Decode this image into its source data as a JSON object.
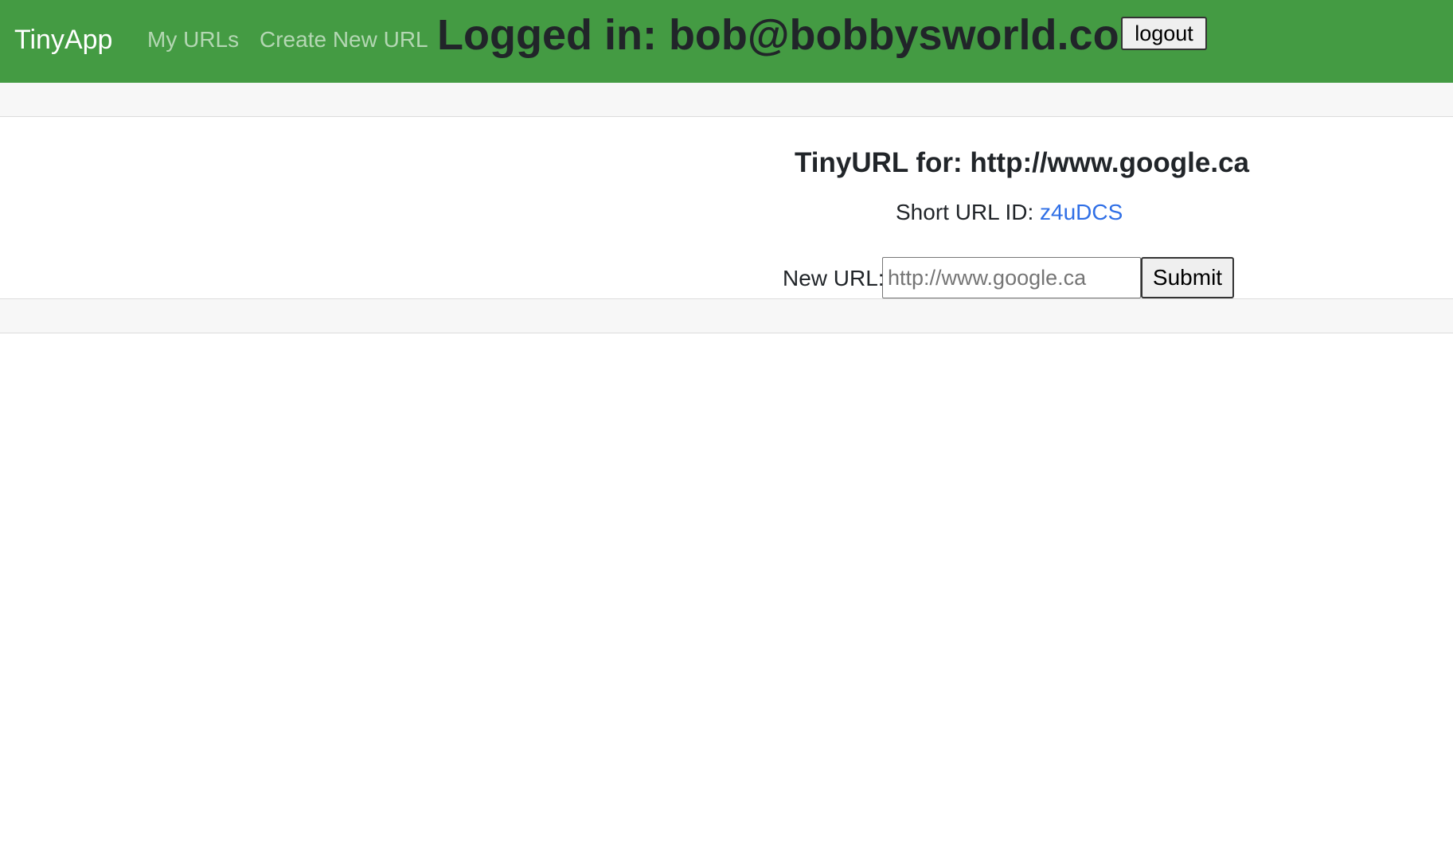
{
  "header": {
    "brand": "TinyApp",
    "nav_links": [
      "My URLs",
      "Create New URL"
    ],
    "logged_in_prefix": "Logged in: ",
    "user_email": "bob@bobbysworld.com",
    "logout_label": "logout",
    "background_color": "#449b43"
  },
  "main": {
    "title_prefix": "TinyURL for: ",
    "long_url": "http://www.google.ca",
    "short_url_label": "Short URL ID: ",
    "short_url_id": "z4uDCS",
    "link_color": "#2f6fe6"
  },
  "form": {
    "new_url_label": "New URL:",
    "new_url_placeholder": "http://www.google.ca",
    "submit_label": "Submit"
  }
}
